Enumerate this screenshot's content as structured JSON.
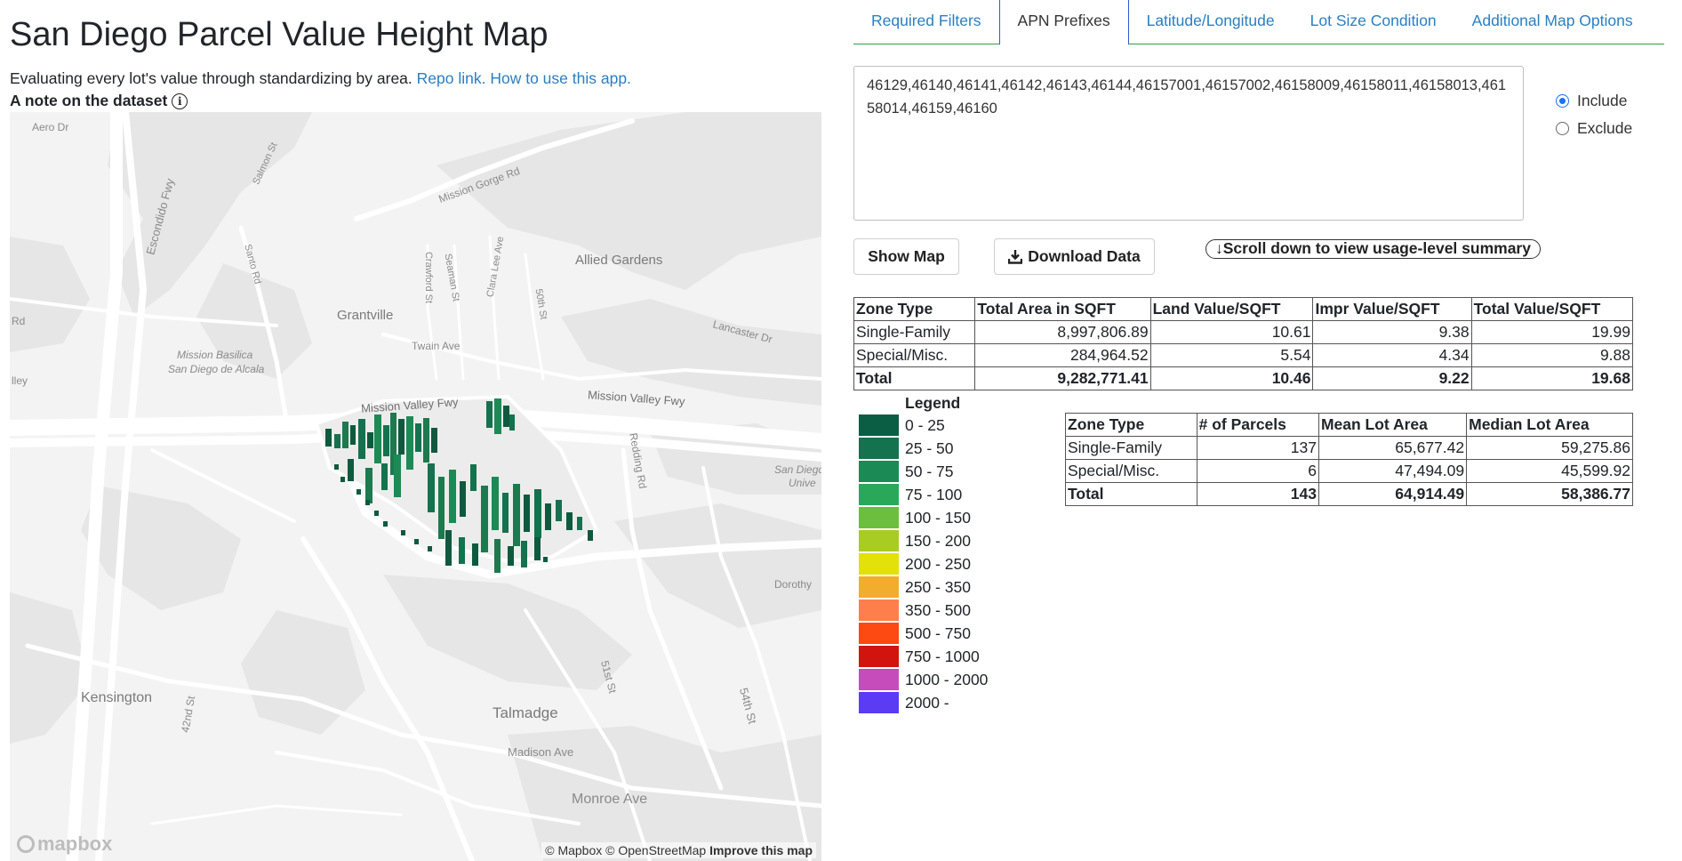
{
  "header": {
    "title": "San Diego Parcel Value Height Map",
    "subtitle_text": "Evaluating every lot's value through standardizing by area.",
    "repo_link": "Repo link.",
    "howto_link": "How to use this app.",
    "note_label": "A note on the dataset",
    "info_icon": "i"
  },
  "map": {
    "labels": {
      "aero_dr": "Aero Dr",
      "salmon_st": "Salmon St",
      "mission_gorge_rd": "Mission Gorge Rd",
      "escondido_fwy": "Escondido Fwy",
      "santo_rd": "Santo Rd",
      "allied_gardens": "Allied Gardens",
      "crawford_st": "Crawford St",
      "seaman_st": "Seaman St",
      "clara_lee_ave": "Clara Lee Ave",
      "fiftieth_st": "50th St",
      "rd": "Rd",
      "grantville": "Grantville",
      "lancaster_dr": "Lancaster Dr",
      "twain_ave": "Twain Ave",
      "mission_basilica": "Mission Basilica",
      "san_diego_de_alcala": "San Diego de Alcala",
      "lley": "lley",
      "mission_valley_fwy_1": "Mission Valley Fwy",
      "mission_valley_fwy_2": "Mission Valley Fwy",
      "redding_rd": "Redding Rd",
      "san_diego_univ_1": "San Diego",
      "san_diego_univ_2": "Unive",
      "dorothy": "Dorothy",
      "fiftyfirst_st": "51st St",
      "kensington": "Kensington",
      "fortysecond_st": "42nd St",
      "talmadge": "Talmadge",
      "fiftyfourth_st": "54th St",
      "madison_ave": "Madison Ave",
      "monroe_ave": "Monroe Ave"
    },
    "attribution_mapbox": "© Mapbox",
    "attribution_osm": "© OpenStreetMap",
    "improve_link": "Improve this map",
    "logo_text": "mapbox"
  },
  "tabs": [
    {
      "label": "Required Filters"
    },
    {
      "label": "APN Prefixes"
    },
    {
      "label": "Latitude/Longitude"
    },
    {
      "label": "Lot Size Condition"
    },
    {
      "label": "Additional Map Options"
    }
  ],
  "apn_input": {
    "value": "46129,46140,46141,46142,46143,46144,46157001,46157002,46158009,46158011,46158013,46158014,46159,46160"
  },
  "filter_mode": {
    "include_label": "Include",
    "exclude_label": "Exclude",
    "selected": "Include"
  },
  "buttons": {
    "show_map": "Show Map",
    "download": "Download Data",
    "scroll_note": "↓Scroll down to view usage-level summary"
  },
  "value_table": {
    "headers": [
      "Zone Type",
      "Total Area in SQFT",
      "Land Value/SQFT",
      "Impr Value/SQFT",
      "Total Value/SQFT"
    ],
    "rows": [
      [
        "Single-Family",
        "8,997,806.89",
        "10.61",
        "9.38",
        "19.99"
      ],
      [
        "Special/Misc.",
        "284,964.52",
        "5.54",
        "4.34",
        "9.88"
      ]
    ],
    "total": [
      "Total",
      "9,282,771.41",
      "10.46",
      "9.22",
      "19.68"
    ]
  },
  "lot_table": {
    "headers": [
      "Zone Type",
      "# of Parcels",
      "Mean Lot Area",
      "Median Lot Area"
    ],
    "rows": [
      [
        "Single-Family",
        "137",
        "65,677.42",
        "59,275.86"
      ],
      [
        "Special/Misc.",
        "6",
        "47,494.09",
        "45,599.92"
      ]
    ],
    "total": [
      "Total",
      "143",
      "64,914.49",
      "58,386.77"
    ]
  },
  "legend": {
    "title": "Legend",
    "items": [
      {
        "label": "0 - 25",
        "color": "#0b5e44"
      },
      {
        "label": "25 - 50",
        "color": "#14724e"
      },
      {
        "label": "50 - 75",
        "color": "#1c8a55"
      },
      {
        "label": "75 - 100",
        "color": "#2aa85a"
      },
      {
        "label": "100 - 150",
        "color": "#6cbf3c"
      },
      {
        "label": "150 - 200",
        "color": "#a9cc23"
      },
      {
        "label": "200 - 250",
        "color": "#e3e10a"
      },
      {
        "label": "250 - 350",
        "color": "#f2ad2d"
      },
      {
        "label": "350 - 500",
        "color": "#fe7f4c"
      },
      {
        "label": "500 - 750",
        "color": "#fd4a12"
      },
      {
        "label": "750 - 1000",
        "color": "#d1140d"
      },
      {
        "label": "1000 - 2000",
        "color": "#c64cbb"
      },
      {
        "label": "2000 -",
        "color": "#5b3cf4"
      }
    ]
  }
}
